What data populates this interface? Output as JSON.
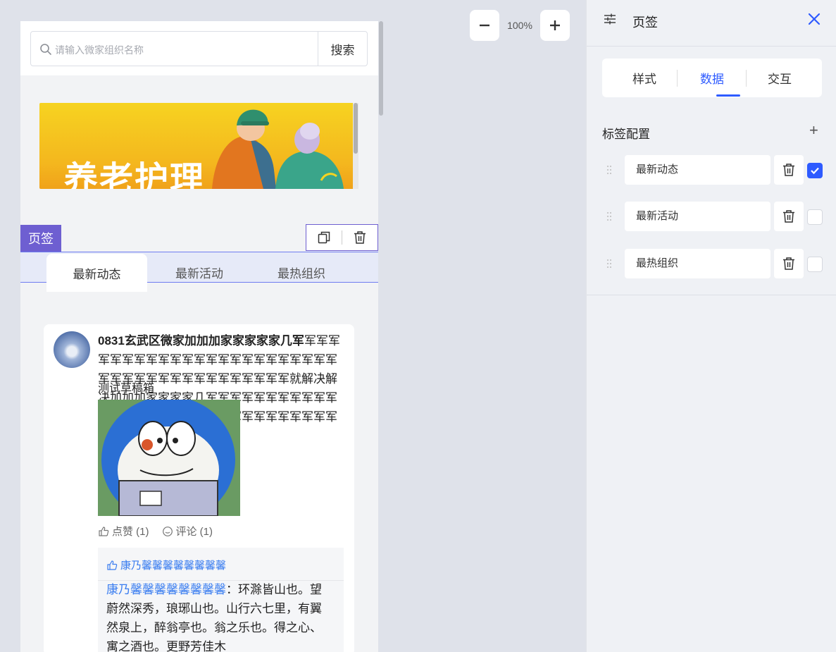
{
  "canvas": {
    "search": {
      "placeholder": "请输入微家组织名称",
      "button": "搜索"
    },
    "banner": {
      "title": "养老护理"
    },
    "component": {
      "label": "页签"
    },
    "tabs": [
      {
        "label": "最新动态",
        "active": true
      },
      {
        "label": "最新活动",
        "active": false
      },
      {
        "label": "最热组织",
        "active": false
      }
    ],
    "post": {
      "title": "0831玄武区微家加加加家家家家家几军",
      "body": "军军军军军军军军军军军军军军军军军军军军军军军军军军军军军军军军军军军军军军军就解决解决加加加家家家家几军军军军军军军军军军军军军军军军军军军军军军军军军军军军军军军军军",
      "overlay": "测试草稿箱",
      "likes_label": "点赞 (1)",
      "comments_label": "评论 (1)",
      "likers": "康乃馨馨馨馨馨馨馨馨",
      "comment_author": "康乃馨馨馨馨馨馨馨馨",
      "comment_text": "：环滁皆山也。望蔚然深秀，琅琊山也。山行六七里，有翼然泉上，醉翁亭也。翁之乐也。得之心、寓之酒也。更野芳佳木"
    }
  },
  "zoom": {
    "value": "100%",
    "minus": "—",
    "plus": "+"
  },
  "panel": {
    "title": "页签",
    "segments": [
      {
        "label": "样式",
        "active": false
      },
      {
        "label": "数据",
        "active": true
      },
      {
        "label": "交互",
        "active": false
      }
    ],
    "section_title": "标签配置",
    "add": "+",
    "rows": [
      {
        "label": "最新动态",
        "checked": true
      },
      {
        "label": "最新活动",
        "checked": false
      },
      {
        "label": "最热组织",
        "checked": false
      }
    ]
  },
  "colors": {
    "accent": "#2e5bff",
    "component": "#6e5fd1",
    "link": "#3a7df0"
  }
}
